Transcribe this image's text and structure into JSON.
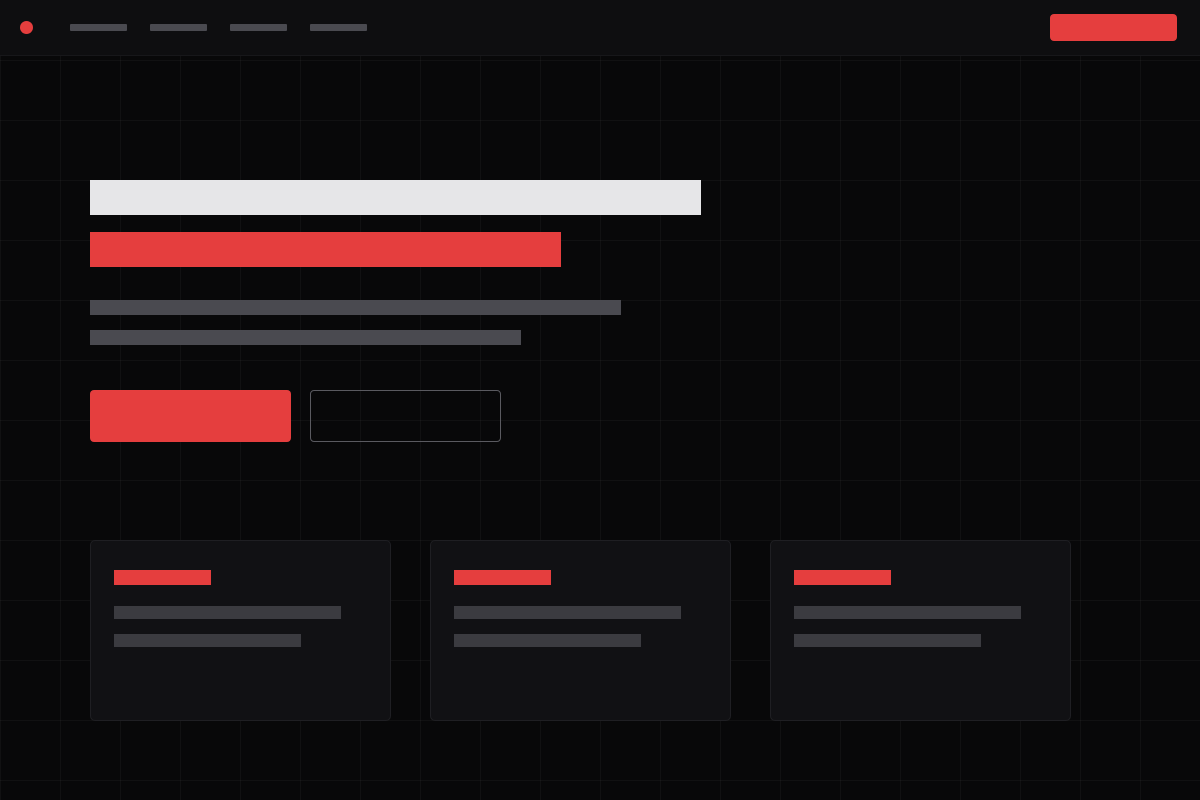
{
  "theme": {
    "accent": "#e53e3e",
    "heading_fill": "#e6e6e8",
    "text_fill": "#4a4a50",
    "background": "#080809"
  },
  "nav": {
    "logo": "logo-dot-icon",
    "items": [
      "",
      "",
      "",
      ""
    ],
    "cta_label": ""
  },
  "hero": {
    "heading_line_1": "",
    "heading_line_2": "",
    "paragraph_line_1": "",
    "paragraph_line_2": "",
    "primary_button_label": "",
    "secondary_button_label": ""
  },
  "cards": [
    {
      "title": "",
      "line_1": "",
      "line_2": ""
    },
    {
      "title": "",
      "line_1": "",
      "line_2": ""
    },
    {
      "title": "",
      "line_1": "",
      "line_2": ""
    }
  ]
}
